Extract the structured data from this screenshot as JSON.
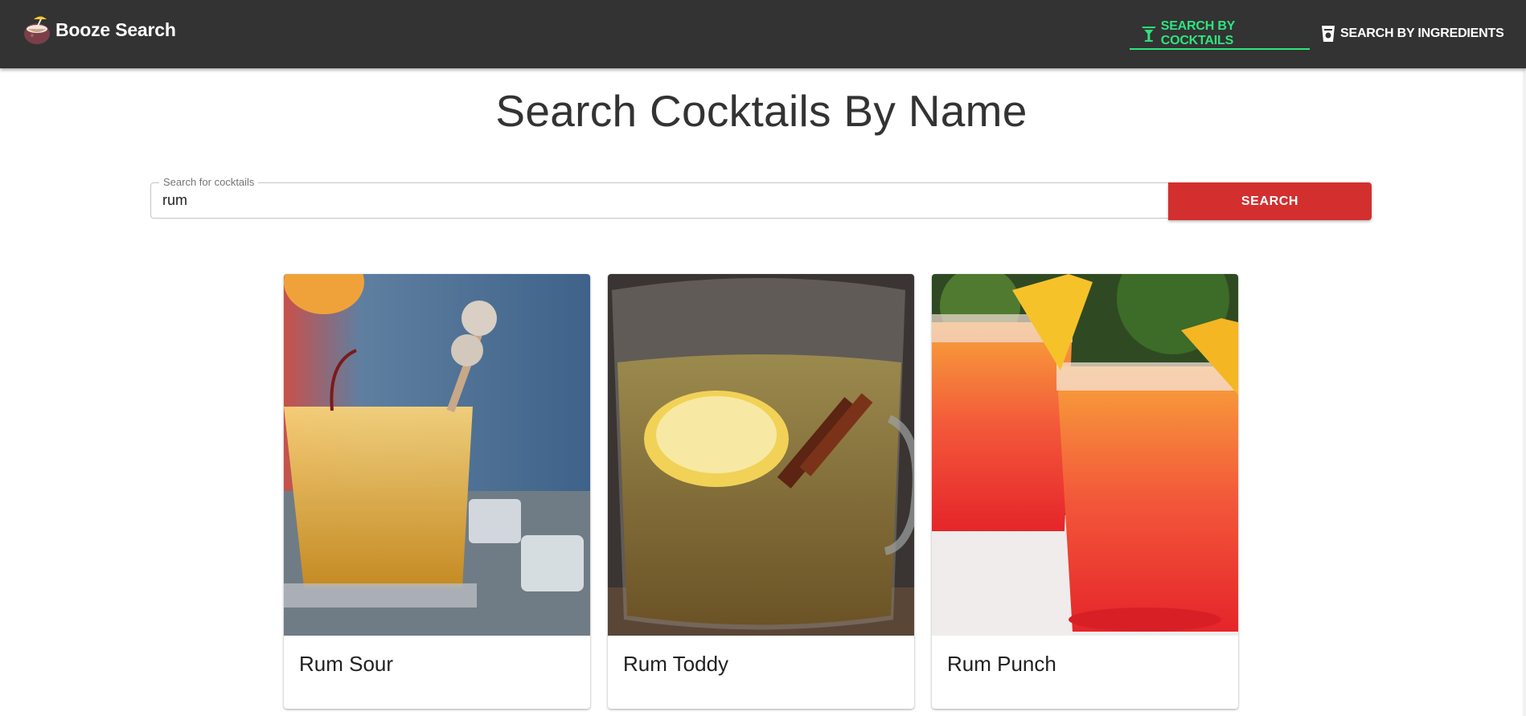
{
  "app": {
    "brand_name": "Booze Search",
    "logo_icon": "coconut-drink-icon"
  },
  "nav": {
    "tabs": [
      {
        "label": "SEARCH BY COCKTAILS",
        "icon": "martini-glass-icon",
        "active": true
      },
      {
        "label": "SEARCH BY INGREDIENTS",
        "icon": "bottle-icon",
        "active": false
      }
    ]
  },
  "main": {
    "title": "Search Cocktails By Name",
    "search": {
      "label": "Search for cocktails",
      "value": "rum",
      "button_label": "SEARCH"
    },
    "results": [
      {
        "name": "Rum Sour"
      },
      {
        "name": "Rum Toddy"
      },
      {
        "name": "Rum Punch"
      }
    ]
  },
  "colors": {
    "appbar": "#333333",
    "active_tab": "#2ee57e",
    "search_button": "#d32f2f"
  }
}
